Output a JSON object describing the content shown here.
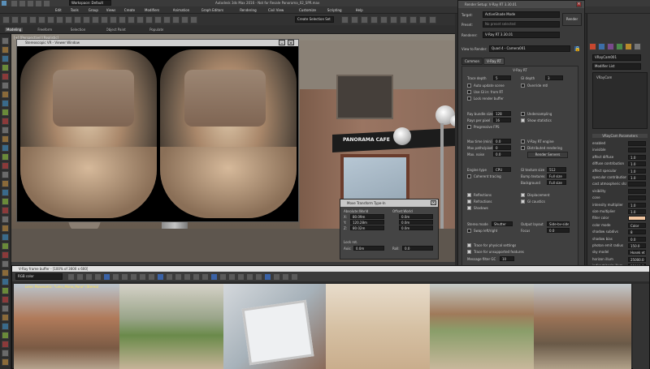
{
  "app": {
    "title": "Autodesk 3ds Max 2016 - Not for Resale   Panorama_02_SPR.max",
    "workspace": "Workspace: Default",
    "menus": [
      "Edit",
      "Tools",
      "Group",
      "Views",
      "Create",
      "Modifiers",
      "Animation",
      "Graph Editors",
      "Rendering",
      "Civil View",
      "Customize",
      "Scripting",
      "Help"
    ],
    "create_selection_set": "Create Selection Set",
    "ribbon_tabs": [
      "Modeling",
      "Freeform",
      "Selection",
      "Object Paint",
      "Populate"
    ]
  },
  "viewport": {
    "label": "[+] [Perspective] [Realistic]",
    "sign_text": "PANORAMA CAFE"
  },
  "stereo_window": {
    "title": "Stereoscopic VR - Viewer Window"
  },
  "render_setup": {
    "title": "Render Setup: V-Ray RT 3.30.01",
    "target_label": "Target:",
    "target_value": "ActiveShade Mode",
    "preset_label": "Preset:",
    "preset_value": "No preset selected",
    "renderer_label": "Renderer:",
    "renderer_value": "V-Ray RT 3.30.01",
    "render_button": "Render",
    "view_label": "View to Render:",
    "view_value": "Quad 4 - Camera001",
    "tabs": [
      "Common",
      "V-Ray RT"
    ],
    "section_title": "V-Ray RT",
    "trace_depth_label": "Trace depth",
    "trace_depth_value": "5",
    "gi_depth_label": "GI depth",
    "gi_depth_value": "3",
    "auto_update_label": "Auto update scene",
    "override_mtl_label": "Override mtl",
    "use_irr_label": "Use GI irr. from RT",
    "lock_render_label": "Lock render buffer",
    "ray_bundle_label": "Ray bundle size",
    "ray_bundle_value": "128",
    "rays_per_pixel_label": "Rays per pixel",
    "rays_per_pixel_value": "16",
    "progressive_label": "Progressive FPS",
    "undersampling_label": "Undersampling",
    "show_statistics_label": "Show statistics",
    "max_time_label": "Max time (min)",
    "max_time_value": "0.0",
    "max_paths_label": "Max paths/pixel",
    "max_paths_value": "0",
    "max_noise_label": "Max. noise",
    "max_noise_value": "0.0",
    "distributed_label": "Distributed rendering",
    "render_servers_button": "Render Servers",
    "cpu_rt_label": "V-Ray RT engine",
    "engine_type_label": "Engine type",
    "engine_type_value": "CPU",
    "gi_caustics_label": "GI caustics",
    "displacement_label": "Displacement",
    "opencl_label": "Coherent tracing",
    "gi_texture_label": "GI texture size",
    "gi_texture_value": "512",
    "bump_texture_label": "Bump textures",
    "bump_texture_value": "Full size",
    "background_label": "Background",
    "background_value": "Full size",
    "reflections_label": "Reflections",
    "refractions_label": "Refractions",
    "shadows_label": "Shadows",
    "indirect_label": "Indirect lights",
    "stereo_mode_label": "Stereo mode",
    "stereo_mode_value": "Shutter",
    "output_layout_label": "Output layout",
    "output_layout_value": "Side-by-side",
    "swap_eyes_label": "Swap left/right",
    "eye_distance_label": "Eye distance",
    "focus_label": "Focus",
    "focus_value": "0.0",
    "cam_opt_label": "Trace for physical settings",
    "limit_label": "Trace for unsupported features",
    "mesh_label": "Message filter GC",
    "mesh_value": "10"
  },
  "move_transform": {
    "title": "Move Transform Type-In",
    "absolute_label": "Absolute:World",
    "offset_label": "Offset:World",
    "x_value": "80.09m",
    "y_value": "120.28m",
    "z_value": "80.02m",
    "x_off": "0.0m",
    "y_off": "0.0m",
    "z_off": "0.0m",
    "lock_label": "Lock rot.",
    "axis_label": "Axis:",
    "axis_value": "0.0m",
    "angle_label": "Roll:",
    "angle_value": "0.0"
  },
  "command_panel": {
    "object_name": "VRayCam001",
    "modifier_list": "Modifier List",
    "stack_item": "VRayCam",
    "params_title": "VRayCam Parameters",
    "params": [
      {
        "label": "enabled",
        "value": ""
      },
      {
        "label": "invisible",
        "value": ""
      },
      {
        "label": "affect diffuse",
        "value": "1.0"
      },
      {
        "label": "diffuse contribution",
        "value": "1.0"
      },
      {
        "label": "affect specular",
        "value": "1.0"
      },
      {
        "label": "specular contribution",
        "value": "1.0"
      },
      {
        "label": "cast atmospheric shadows",
        "value": ""
      },
      {
        "label": "visibility",
        "value": ""
      },
      {
        "label": "cone",
        "value": ""
      },
      {
        "label": "intensity multiplier",
        "value": "1.0"
      },
      {
        "label": "size multiplier",
        "value": "1.0"
      },
      {
        "label": "filter color",
        "value": ""
      },
      {
        "label": "color mode",
        "value": "Color"
      },
      {
        "label": "shadow subdivs",
        "value": "8"
      },
      {
        "label": "shadow bias",
        "value": "0.0"
      },
      {
        "label": "photon emit radius",
        "value": "150.0"
      },
      {
        "label": "sky model",
        "value": "Hosek et al."
      },
      {
        "label": "horizon illum",
        "value": "25000.0"
      },
      {
        "label": "indirect horiz illum",
        "value": "25000.0"
      }
    ]
  },
  "frame_buffer": {
    "title": "V-Ray frame buffer - [100% of 3600 x 600]",
    "channel": "RGB color",
    "overlay_text": "Lens: Panoramic: \"Lens_Mono_Pano\" (Stereo)"
  }
}
